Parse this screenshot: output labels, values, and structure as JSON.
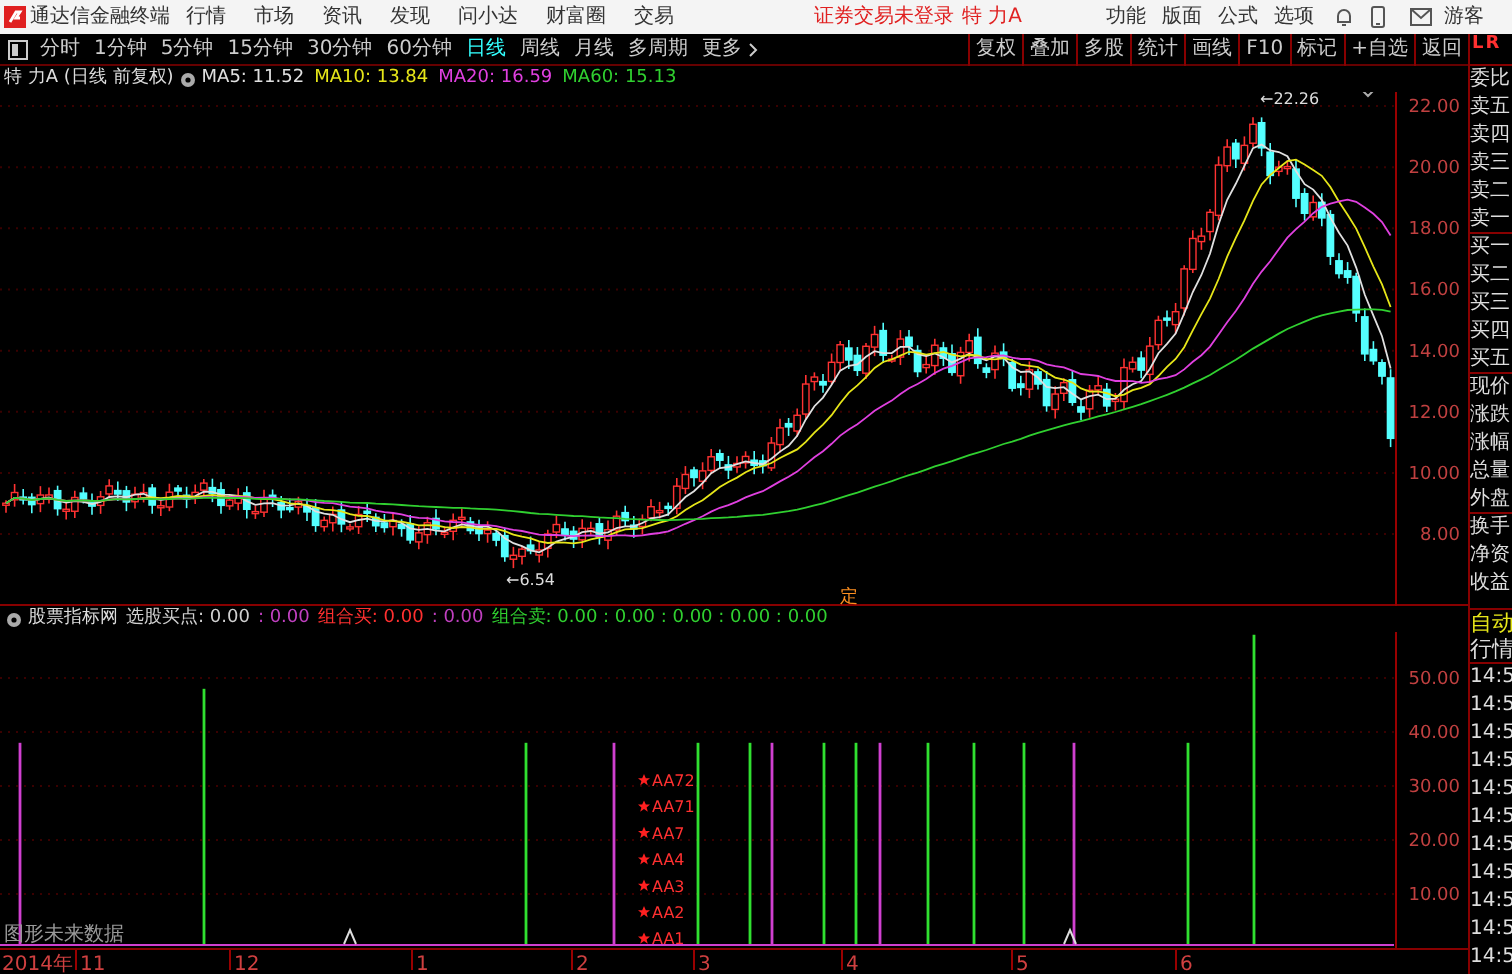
{
  "top_bar": {
    "app_title": "通达信金融终端",
    "menu": [
      "行情",
      "市场",
      "资讯",
      "发现",
      "问小达",
      "财富圈",
      "交易"
    ],
    "login_status": "证券交易未登录",
    "stock": "特 力A",
    "right_menu": [
      "功能",
      "版面",
      "公式",
      "选项"
    ],
    "user": "游客"
  },
  "period_tabs": [
    {
      "label": "分时",
      "selected": false
    },
    {
      "label": "1分钟",
      "selected": false
    },
    {
      "label": "5分钟",
      "selected": false
    },
    {
      "label": "15分钟",
      "selected": false
    },
    {
      "label": "30分钟",
      "selected": false
    },
    {
      "label": "60分钟",
      "selected": false
    },
    {
      "label": "日线",
      "selected": true
    },
    {
      "label": "周线",
      "selected": false
    },
    {
      "label": "月线",
      "selected": false
    },
    {
      "label": "多周期",
      "selected": false
    },
    {
      "label": "更多",
      "selected": false
    }
  ],
  "tool_buttons": [
    "复权",
    "叠加",
    "多股",
    "统计",
    "画线",
    "F10",
    "标记",
    "+自选",
    "返回"
  ],
  "chart_title": "特 力A (日线 前复权)",
  "ma_legend": [
    {
      "label": "MA5: 11.52",
      "color": "#e0e0e0"
    },
    {
      "label": "MA10: 13.84",
      "color": "#e6e619"
    },
    {
      "label": "MA20: 16.59",
      "color": "#e040e0"
    },
    {
      "label": "MA60: 15.13",
      "color": "#30d030"
    }
  ],
  "price_axis": [
    "22.00",
    "20.00",
    "18.00",
    "16.00",
    "14.00",
    "12.00",
    "10.00",
    "8.00"
  ],
  "price_annotations": {
    "high": "←22.26",
    "low": "←6.54"
  },
  "marker": "定",
  "indicator_header": {
    "name": "股票指标网",
    "segments": [
      {
        "text": "选股买点: 0.00",
        "color": "#d0d0d0"
      },
      {
        "text": ": 0.00",
        "color": "#c040c0"
      },
      {
        "text": "组合买: 0.00",
        "color": "#ff3030"
      },
      {
        "text": ": 0.00",
        "color": "#c040c0"
      },
      {
        "text": "组合卖: 0.00 : 0.00 : 0.00 : 0.00 : 0.00",
        "color": "#30d030"
      }
    ]
  },
  "signal_labels": [
    "AA72",
    "AA71",
    "AA7",
    "AA4",
    "AA3",
    "AA2",
    "AA1"
  ],
  "indicator_axis": [
    "50.00",
    "40.00",
    "30.00",
    "20.00",
    "10.00"
  ],
  "footer_note": "图形未来数据",
  "date_axis": [
    "2014年",
    "11",
    "12",
    "1",
    "2",
    "3",
    "4",
    "5",
    "6"
  ],
  "quote_panel": {
    "badge": [
      "L",
      "R"
    ],
    "labels": [
      "委比",
      "卖五",
      "卖四",
      "卖三",
      "卖二",
      "卖一",
      "买一",
      "买二",
      "买三",
      "买四",
      "买五",
      "现价",
      "涨跌",
      "涨幅",
      "总量",
      "外盘",
      "换手",
      "净资",
      "收益"
    ],
    "mode_buttons": [
      "自动",
      "行情"
    ],
    "times": [
      "14:5",
      "14:5",
      "14:5",
      "14:5",
      "14:5",
      "14:5",
      "14:5",
      "14:5",
      "14:5",
      "14:5",
      "14:5"
    ]
  }
}
